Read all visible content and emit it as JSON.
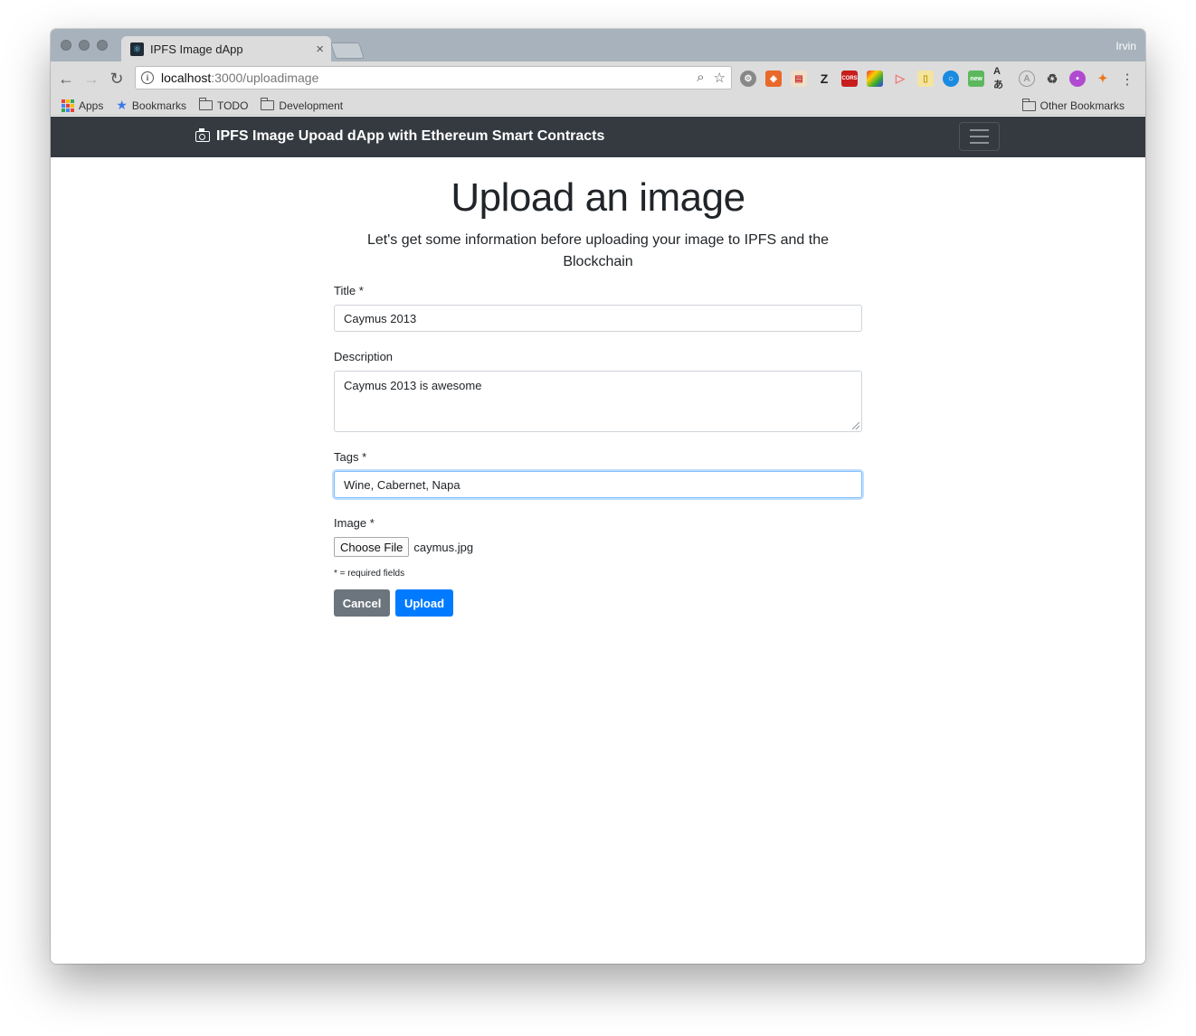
{
  "browser": {
    "tab_title": "IPFS Image dApp",
    "profile_name": "Irvin",
    "url_host": "localhost",
    "url_path": ":3000/uploadimage",
    "bookmarks": {
      "apps": "Apps",
      "bookmarks": "Bookmarks",
      "todo": "TODO",
      "development": "Development",
      "other": "Other Bookmarks"
    },
    "extension_badge": "new"
  },
  "navbar": {
    "brand": "IPFS Image Upoad dApp with Ethereum Smart Contracts"
  },
  "page": {
    "heading": "Upload an image",
    "lead": "Let's get some information before uploading your image to IPFS and the Blockchain"
  },
  "form": {
    "title_label": "Title *",
    "title_value": "Caymus 2013",
    "description_label": "Description",
    "description_value": "Caymus 2013 is awesome",
    "tags_label": "Tags *",
    "tags_value": "Wine, Cabernet, Napa",
    "image_label": "Image *",
    "choose_file_label": "Choose File",
    "file_name": "caymus.jpg",
    "required_note": "* = required fields",
    "cancel_label": "Cancel",
    "upload_label": "Upload"
  },
  "colors": {
    "navbar_bg": "#343a40",
    "primary": "#007bff",
    "secondary": "#6c757d"
  }
}
